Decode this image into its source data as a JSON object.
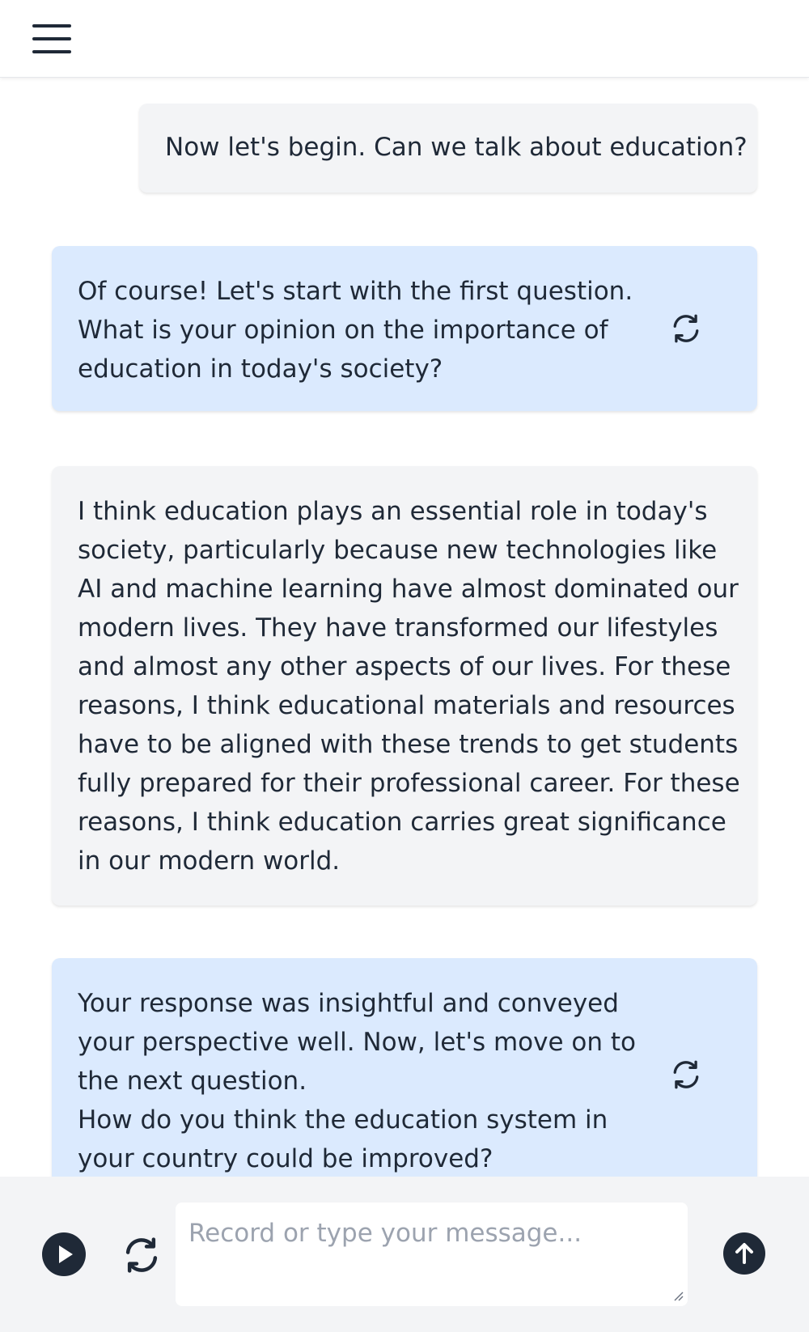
{
  "header": {
    "menu_icon": "hamburger-menu-icon"
  },
  "messages": [
    {
      "role": "user",
      "text": "Now let's begin. Can we talk about education?"
    },
    {
      "role": "assistant",
      "text": "Of course! Let's start with the first question.\nWhat is your opinion on the importance of\neducation in today's society?",
      "action_icon": "refresh-icon"
    },
    {
      "role": "user",
      "text": "I think education plays an essential role in today's\nsociety, particularly because new technologies like\nAI and machine learning have almost dominated our\nmodern lives. They have transformed our lifestyles\nand almost any other aspects of our lives. For these\nreasons, I think educational materials and resources\nhave to be aligned with these trends to get students\nfully prepared for their professional career. For these\nreasons, I think education carries great significance\nin our modern world."
    },
    {
      "role": "assistant",
      "text": "Your response was insightful and conveyed\nyour perspective well. Now, let's move on to\nthe next question.\nHow do you think the education system in\nyour country could be improved?",
      "action_icon": "refresh-icon"
    }
  ],
  "composer": {
    "placeholder": "Record or type your message...",
    "value": "",
    "play_icon": "play-circle-icon",
    "refresh_icon": "refresh-icon",
    "send_icon": "arrow-up-circle-icon"
  },
  "colors": {
    "user_bubble": "#f3f4f6",
    "assistant_bubble": "#dbeafe",
    "text": "#1f2937",
    "icon_dark": "#1f2937",
    "placeholder": "#9ca3af"
  }
}
